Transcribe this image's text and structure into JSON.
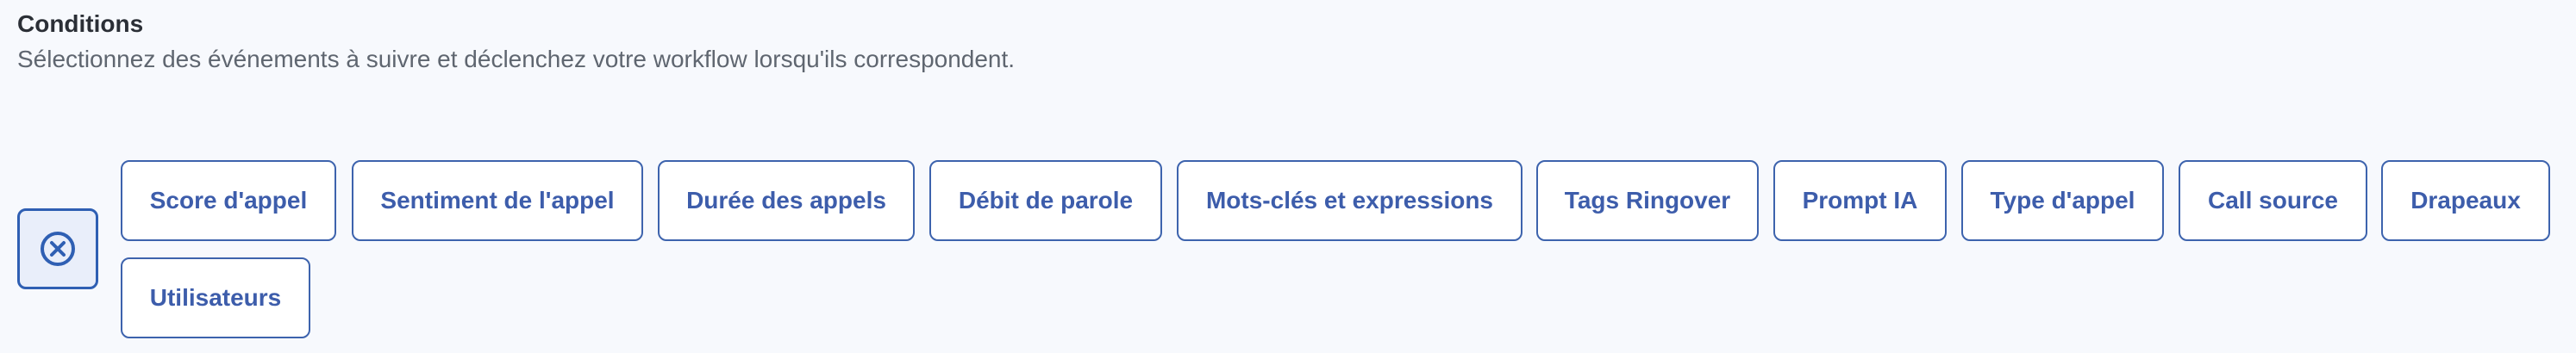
{
  "conditions": {
    "title": "Conditions",
    "subtitle": "Sélectionnez des événements à suivre et déclenchez votre workflow lorsqu'ils correspondent.",
    "remove_icon": "close-circle-icon",
    "accent_color": "#3d63ad",
    "options": [
      "Score d'appel",
      "Sentiment de l'appel",
      "Durée des appels",
      "Débit de parole",
      "Mots-clés et expressions",
      "Tags Ringover",
      "Prompt IA",
      "Type d'appel",
      "Call source",
      "Drapeaux",
      "Utilisateurs"
    ]
  }
}
